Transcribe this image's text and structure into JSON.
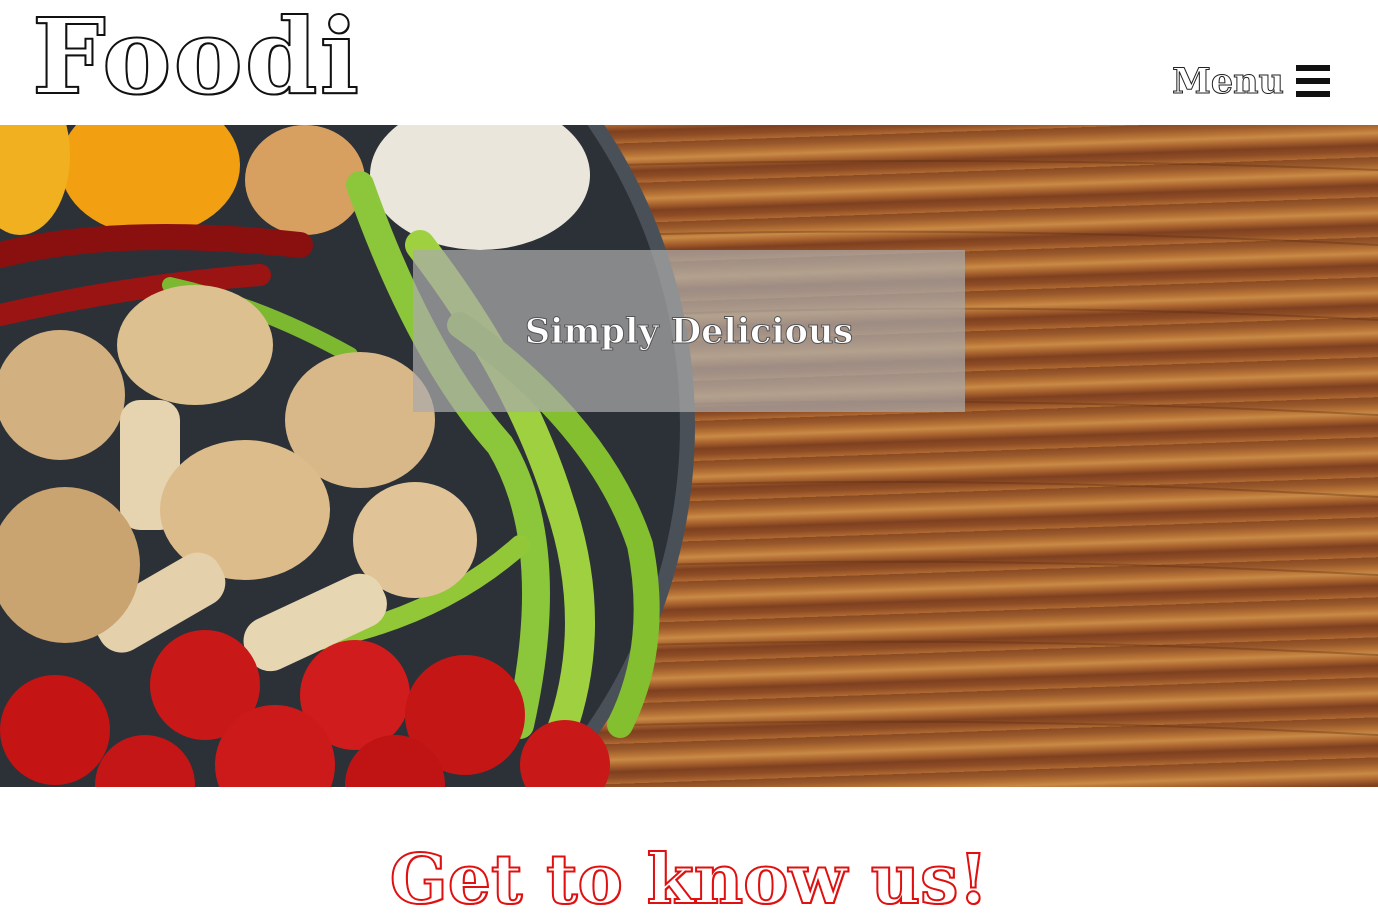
{
  "header": {
    "logo_text": "Foodi",
    "menu_label": "Menu",
    "menu_icon": "hamburger-icon"
  },
  "hero": {
    "tagline": "Simply Delicious",
    "image": "vegetables-on-pan-over-wooden-table"
  },
  "about": {
    "heading": "Get to know us!"
  },
  "colors": {
    "heading_accent": "#e01010",
    "overlay": "#aaaaaa",
    "wood": "#9b5a2c"
  }
}
